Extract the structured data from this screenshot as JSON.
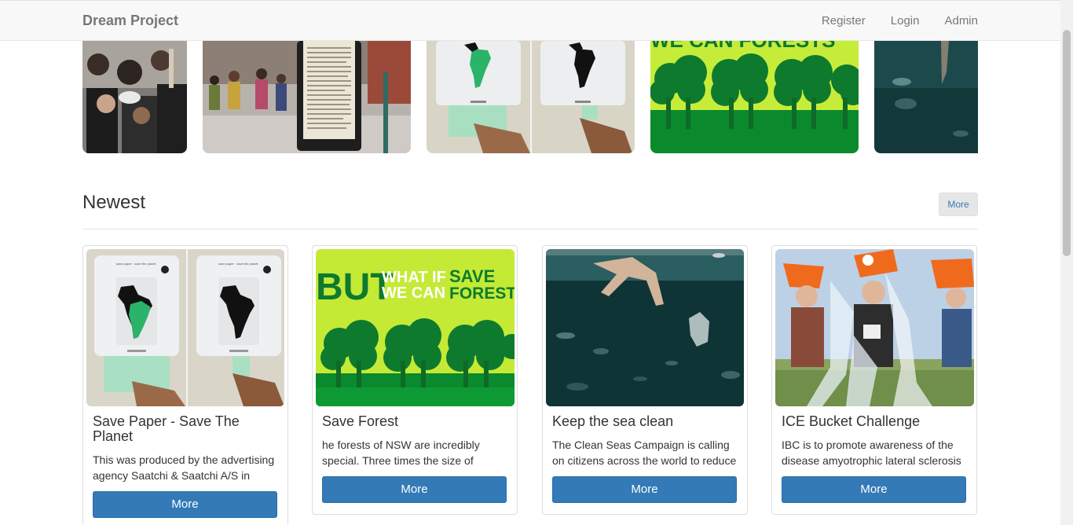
{
  "nav": {
    "brand": "Dream Project",
    "links": [
      "Register",
      "Login",
      "Admin"
    ]
  },
  "carousel": {
    "slides": [
      "protest-crowd-image",
      "street-poster-image",
      "paper-towel-dispenser-image",
      "save-forests-image",
      "sea-plastic-image"
    ]
  },
  "section": {
    "title": "Newest",
    "more_label": "More"
  },
  "cards": [
    {
      "title": "Save Paper - Save The Planet",
      "text": "This was produced by the advertising agency Saatchi & Saatchi A/S in",
      "button": "More"
    },
    {
      "title": "Save Forest",
      "text": "he forests of NSW are incredibly special. Three times the size of",
      "button": "More"
    },
    {
      "title": "Keep the sea clean",
      "text": "The Clean Seas Campaign is calling on citizens across the world to reduce",
      "button": "More"
    },
    {
      "title": "ICE Bucket Challenge",
      "text": "IBC is to promote awareness of the disease amyotrophic lateral sclerosis",
      "button": "More"
    }
  ],
  "forest_poster": {
    "but": "BUT",
    "what_if": "WHAT IF",
    "we_can": "WE CAN",
    "save": "SAVE",
    "forests": "FORESTS",
    "partial": "WE CAN FORESTS"
  },
  "dispenser_caption": "save paper · save the planet",
  "colors": {
    "primary": "#337ab7",
    "navbar_bg": "#f8f8f8",
    "forest_green": "#0e7a2e",
    "lime": "#b7e33b"
  }
}
